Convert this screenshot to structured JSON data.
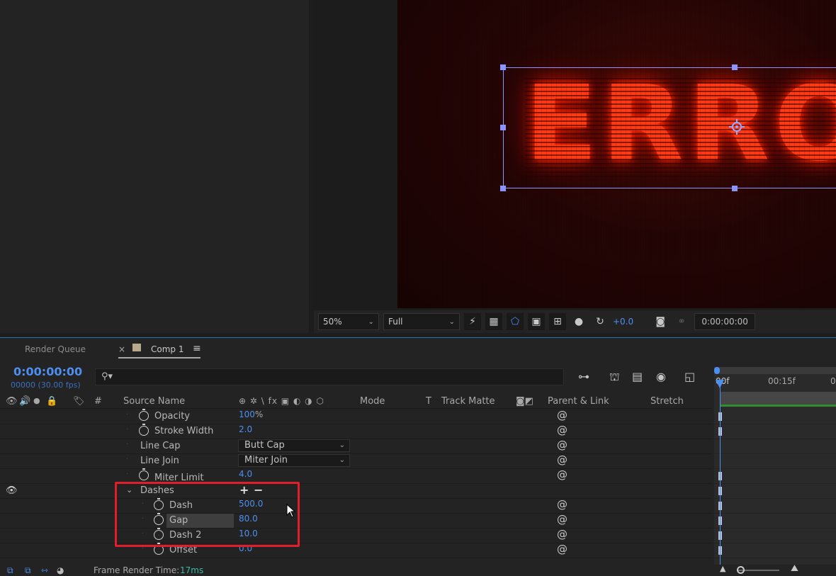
{
  "viewer": {
    "comp_text": "ERRO",
    "zoom": "50%",
    "resolution": "Full",
    "exposure": "+0.0",
    "timecode": "0:00:00:00"
  },
  "timeline": {
    "tabs": {
      "render_queue": "Render Queue",
      "comp": "Comp 1",
      "close": "×",
      "menu": "≡"
    },
    "current_time": "0:00:00:00",
    "fps": "00000 (30.00 fps)",
    "columns": {
      "hash": "#",
      "source_name": "Source Name",
      "switches": "⊕ ✲ \\ fx ▣ ◐ ◑ ⬡",
      "mode": "Mode",
      "t": "T",
      "track_matte": "Track Matte",
      "parent_link": "Parent & Link",
      "stretch": "Stretch"
    },
    "rows": [
      {
        "name": "Opacity",
        "value": "100",
        "unit": "%"
      },
      {
        "name": "Stroke Width",
        "value": "2.0"
      },
      {
        "name": "Line Cap",
        "select": "Butt Cap"
      },
      {
        "name": "Line Join",
        "select": "Miter Join"
      },
      {
        "name": "Miter Limit",
        "value": "4.0"
      },
      {
        "name": "Dashes",
        "add": "+",
        "remove": "−"
      },
      {
        "name": "Dash",
        "value": "500.0"
      },
      {
        "name": "Gap",
        "value": "80.0"
      },
      {
        "name": "Dash 2",
        "value": "10.0"
      },
      {
        "name": "Offset",
        "value": "0.0"
      }
    ],
    "ruler": {
      "start": "00f",
      "mid": "00:15f",
      "end": "0"
    }
  },
  "status": {
    "label": "Frame Render Time:",
    "value": "17ms"
  },
  "colors": {
    "accent_blue": "#4d8ff0",
    "highlight_red": "#e01f2a",
    "glow_red": "#ff3a14"
  }
}
